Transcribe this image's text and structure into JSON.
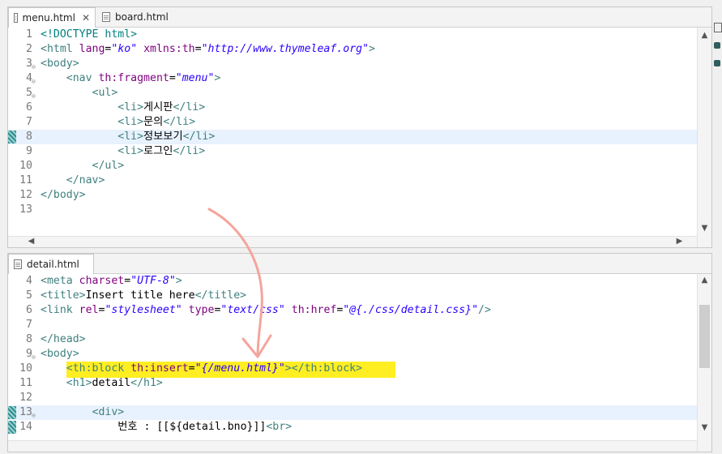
{
  "top_editor": {
    "tabs": [
      {
        "label": "menu.html",
        "active": true,
        "close": "✕"
      },
      {
        "label": "board.html",
        "active": false
      }
    ],
    "lines": [
      {
        "n": "1",
        "html": "<span class='d'>&lt;!DOCTYPE html&gt;</span>"
      },
      {
        "n": "2",
        "html": "<span class='t'>&lt;html</span> <span class='a'>lang</span>=<span class='v'>\"ko\"</span> <span class='a'>xmlns:th</span>=<span class='v'>\"http://www.thymeleaf.org\"</span><span class='t'>&gt;</span>"
      },
      {
        "n": "3",
        "fold": true,
        "html": "<span class='t'>&lt;body&gt;</span>"
      },
      {
        "n": "4",
        "fold": true,
        "html": "    <span class='t'>&lt;nav</span> <span class='a'>th:fragment</span>=<span class='v'>\"menu\"</span><span class='t'>&gt;</span>"
      },
      {
        "n": "5",
        "fold": true,
        "html": "        <span class='t'>&lt;ul&gt;</span>"
      },
      {
        "n": "6",
        "html": "            <span class='t'>&lt;li&gt;</span>게시판<span class='t'>&lt;/li&gt;</span>"
      },
      {
        "n": "7",
        "html": "            <span class='t'>&lt;li&gt;</span>문의<span class='t'>&lt;/li&gt;</span>"
      },
      {
        "n": "8",
        "hl": true,
        "mark": true,
        "html": "            <span class='t'>&lt;li&gt;</span>정보보기<span class='t'>&lt;/li&gt;</span>"
      },
      {
        "n": "9",
        "html": "            <span class='t'>&lt;li&gt;</span>로그인<span class='t'>&lt;/li&gt;</span>"
      },
      {
        "n": "10",
        "html": "        <span class='t'>&lt;/ul&gt;</span>"
      },
      {
        "n": "11",
        "html": "    <span class='t'>&lt;/nav&gt;</span>"
      },
      {
        "n": "12",
        "html": "<span class='t'>&lt;/body&gt;</span>"
      },
      {
        "n": "13",
        "html": ""
      }
    ]
  },
  "bottom_editor": {
    "tabs": [
      {
        "label": "detail.html",
        "active": true
      }
    ],
    "lines": [
      {
        "n": "4",
        "html": "<span class='t'>&lt;meta</span> <span class='a'>charset</span>=<span class='v'>\"UTF-8\"</span><span class='t'>&gt;</span>"
      },
      {
        "n": "5",
        "html": "<span class='t'>&lt;title&gt;</span>Insert title here<span class='t'>&lt;/title&gt;</span>"
      },
      {
        "n": "6",
        "html": "<span class='t'>&lt;link</span> <span class='a'>rel</span>=<span class='v'>\"stylesheet\"</span> <span class='a'>type</span>=<span class='v'>\"text/css\"</span> <span class='a'>th:href</span>=<span class='v'>\"@{./css/detail.css}\"</span><span class='t'>/&gt;</span>"
      },
      {
        "n": "7",
        "html": ""
      },
      {
        "n": "8",
        "html": "<span class='t'>&lt;/head&gt;</span>"
      },
      {
        "n": "9",
        "fold": true,
        "html": "<span class='t'>&lt;body&gt;</span>"
      },
      {
        "n": "10",
        "yellow": true,
        "html": "    <span class='t'>&lt;th:block</span> <span class='a'>th:insert</span>=<span class='v'>\"{/menu.html}\"</span><span class='t'>&gt;&lt;/th:block&gt;</span>"
      },
      {
        "n": "11",
        "html": "    <span class='t'>&lt;h1&gt;</span>detail<span class='t'>&lt;/h1&gt;</span>"
      },
      {
        "n": "12",
        "html": ""
      },
      {
        "n": "13",
        "fold": true,
        "hl": true,
        "mark": true,
        "html": "        <span class='t'>&lt;div&gt;</span>"
      },
      {
        "n": "14",
        "mark": true,
        "html": "            번호 : [[${detail.bno}]]<span class='t'>&lt;br&gt;</span>"
      }
    ]
  },
  "scroll": {
    "up": "▲",
    "down": "▼",
    "left": "◀",
    "right": "▶"
  }
}
